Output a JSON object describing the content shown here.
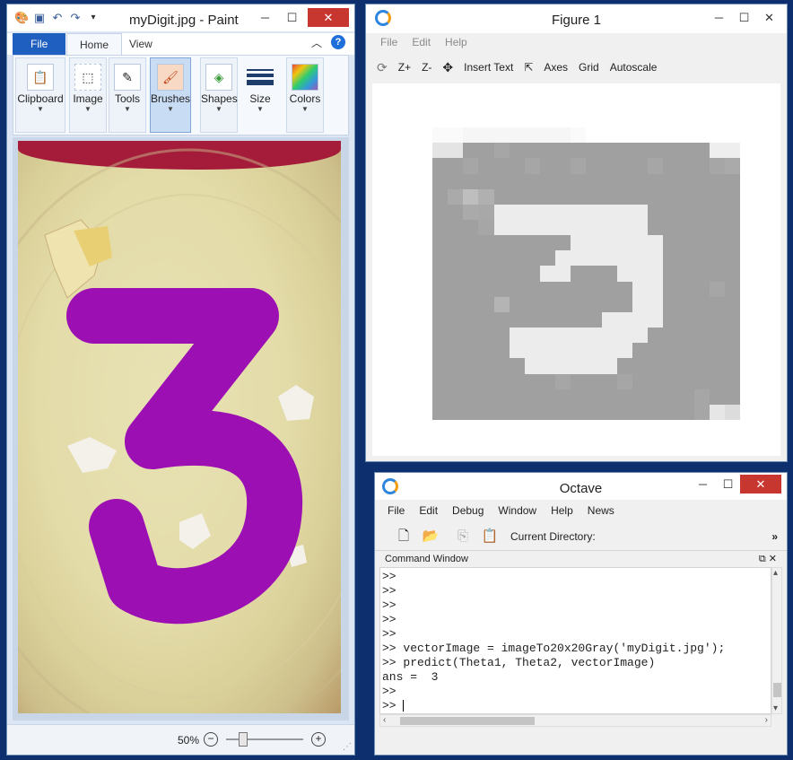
{
  "paint": {
    "title": "myDigit.jpg - Paint",
    "tabs": [
      "File",
      "Home",
      "View"
    ],
    "groups": [
      {
        "label": "Clipboard",
        "icon": "clipboard-icon"
      },
      {
        "label": "Image",
        "icon": "select-icon"
      },
      {
        "label": "Tools",
        "icon": "tools-icon"
      },
      {
        "label": "Brushes",
        "icon": "brush-icon"
      },
      {
        "label": "Shapes",
        "icon": "shapes-icon"
      },
      {
        "label": "Size",
        "icon": "size-icon"
      },
      {
        "label": "Colors",
        "icon": "palette-icon"
      }
    ],
    "zoom": "50%",
    "zoom_fraction": 0.22,
    "digit_color": "#9b0fb3",
    "ribbon_accent": "#1e5fbf"
  },
  "figure": {
    "title": "Figure 1",
    "menu": [
      "File",
      "Edit",
      "Help"
    ],
    "toolbar": [
      "Z+",
      "Z-",
      "Insert Text",
      "Axes",
      "Grid",
      "Autoscale"
    ],
    "pixels": [
      [
        255,
        255,
        255,
        255,
        255,
        255,
        255,
        255,
        255,
        255,
        255,
        255,
        255,
        255,
        255,
        255,
        255,
        255,
        255,
        255
      ],
      [
        250,
        250,
        246,
        246,
        246,
        246,
        246,
        246,
        246,
        250,
        255,
        255,
        255,
        255,
        255,
        255,
        255,
        255,
        255,
        255
      ],
      [
        228,
        228,
        160,
        160,
        166,
        160,
        160,
        160,
        160,
        160,
        160,
        160,
        160,
        160,
        160,
        160,
        160,
        160,
        238,
        238
      ],
      [
        160,
        160,
        166,
        160,
        160,
        160,
        166,
        160,
        160,
        166,
        160,
        160,
        160,
        160,
        166,
        160,
        160,
        160,
        166,
        170
      ],
      [
        160,
        160,
        160,
        160,
        160,
        160,
        160,
        160,
        160,
        160,
        160,
        160,
        160,
        160,
        160,
        160,
        160,
        160,
        160,
        160
      ],
      [
        160,
        170,
        190,
        176,
        160,
        160,
        160,
        160,
        160,
        160,
        160,
        160,
        160,
        160,
        160,
        160,
        160,
        160,
        160,
        160
      ],
      [
        160,
        160,
        170,
        168,
        236,
        236,
        236,
        236,
        236,
        236,
        236,
        236,
        236,
        236,
        160,
        160,
        160,
        160,
        160,
        160
      ],
      [
        160,
        160,
        160,
        166,
        236,
        236,
        236,
        236,
        236,
        236,
        236,
        236,
        236,
        236,
        160,
        160,
        160,
        160,
        160,
        160
      ],
      [
        160,
        160,
        160,
        160,
        160,
        160,
        160,
        160,
        160,
        236,
        236,
        236,
        236,
        236,
        236,
        160,
        160,
        160,
        160,
        160
      ],
      [
        160,
        160,
        160,
        160,
        160,
        160,
        160,
        160,
        236,
        236,
        236,
        236,
        236,
        236,
        236,
        160,
        160,
        160,
        160,
        160
      ],
      [
        160,
        160,
        160,
        160,
        160,
        160,
        160,
        236,
        236,
        160,
        160,
        160,
        236,
        236,
        236,
        160,
        160,
        160,
        160,
        160
      ],
      [
        160,
        160,
        160,
        160,
        160,
        160,
        160,
        160,
        160,
        160,
        160,
        160,
        160,
        236,
        236,
        160,
        160,
        160,
        166,
        160
      ],
      [
        160,
        160,
        160,
        160,
        180,
        160,
        160,
        160,
        160,
        160,
        160,
        160,
        160,
        236,
        236,
        160,
        160,
        160,
        160,
        160
      ],
      [
        160,
        160,
        160,
        160,
        160,
        160,
        160,
        160,
        160,
        160,
        160,
        236,
        236,
        236,
        236,
        160,
        160,
        160,
        160,
        160
      ],
      [
        160,
        160,
        160,
        160,
        160,
        236,
        236,
        236,
        236,
        236,
        236,
        236,
        236,
        236,
        160,
        160,
        160,
        160,
        160,
        160
      ],
      [
        160,
        160,
        160,
        160,
        160,
        236,
        236,
        236,
        236,
        236,
        236,
        236,
        236,
        160,
        160,
        160,
        160,
        160,
        160,
        160
      ],
      [
        160,
        160,
        160,
        160,
        160,
        160,
        236,
        236,
        236,
        236,
        236,
        236,
        160,
        160,
        160,
        160,
        160,
        160,
        160,
        160
      ],
      [
        160,
        160,
        160,
        160,
        160,
        160,
        160,
        160,
        166,
        160,
        160,
        160,
        166,
        160,
        160,
        160,
        160,
        160,
        160,
        160
      ],
      [
        160,
        160,
        160,
        160,
        160,
        160,
        160,
        160,
        160,
        160,
        160,
        160,
        160,
        160,
        160,
        160,
        160,
        166,
        160,
        160
      ],
      [
        160,
        160,
        160,
        160,
        160,
        160,
        160,
        160,
        160,
        160,
        160,
        160,
        160,
        160,
        160,
        160,
        160,
        166,
        230,
        220
      ]
    ]
  },
  "octave": {
    "title": "Octave",
    "menu": [
      "File",
      "Edit",
      "Debug",
      "Window",
      "Help",
      "News"
    ],
    "current_directory_label": "Current Directory:",
    "command_window_label": "Command Window",
    "console_lines": [
      ">>",
      ">>",
      ">>",
      ">>",
      ">>",
      ">> vectorImage = imageTo20x20Gray('myDigit.jpg');",
      ">> predict(Theta1, Theta2, vectorImage)",
      "ans =  3",
      ">>",
      ">> "
    ]
  }
}
